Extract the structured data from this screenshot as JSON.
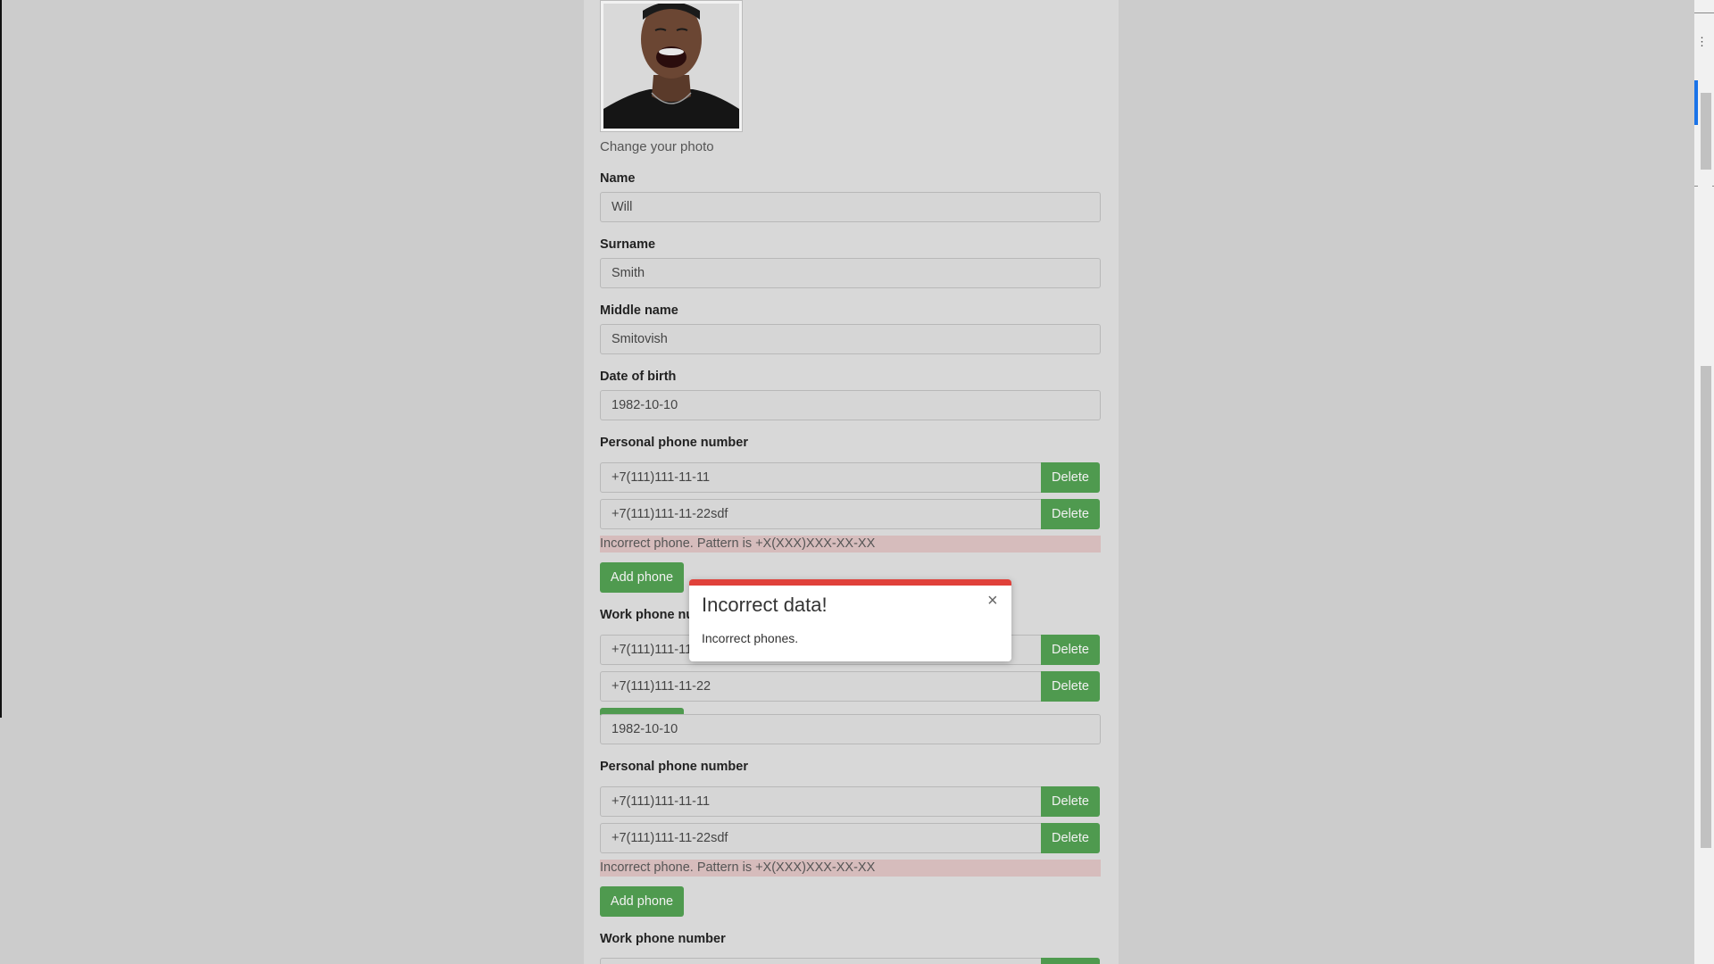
{
  "photo": {
    "caption": "Change your photo"
  },
  "fields": {
    "name": {
      "label": "Name",
      "value": "Will"
    },
    "surname": {
      "label": "Surname",
      "value": "Smith"
    },
    "middle_name": {
      "label": "Middle name",
      "value": "Smitovish"
    },
    "dob": {
      "label": "Date of birth",
      "value": "1982-10-10"
    }
  },
  "personal_phones": {
    "label": "Personal phone number",
    "items": [
      {
        "value": "+7(111)111-11-11",
        "delete_label": "Delete"
      },
      {
        "value": "+7(111)111-11-22sdf",
        "delete_label": "Delete"
      }
    ],
    "error": "Incorrect phone. Pattern is +X(XXX)XXX-XX-XX",
    "add_label": "Add phone"
  },
  "work_phones": {
    "label_partial": "Work phone nu",
    "items": [
      {
        "value": "+7(111)111-11",
        "delete_label": "Delete"
      },
      {
        "value": "+7(111)111-11-22",
        "delete_label": "Delete"
      }
    ]
  },
  "dup": {
    "dob_value": "1982-10-10",
    "personal_label": "Personal phone number",
    "items": [
      {
        "value": "+7(111)111-11-11",
        "delete_label": "Delete"
      },
      {
        "value": "+7(111)111-11-22sdf",
        "delete_label": "Delete"
      }
    ],
    "error": "Incorrect phone. Pattern is +X(XXX)XXX-XX-XX",
    "add_label": "Add phone",
    "work_label": "Work phone number"
  },
  "modal": {
    "title": "Incorrect data!",
    "body": "Incorrect phones.",
    "close_symbol": "×"
  },
  "colors": {
    "success_green": "#4f9a4f",
    "error_bg": "#d6bcbc",
    "modal_accent": "#e0413a"
  }
}
